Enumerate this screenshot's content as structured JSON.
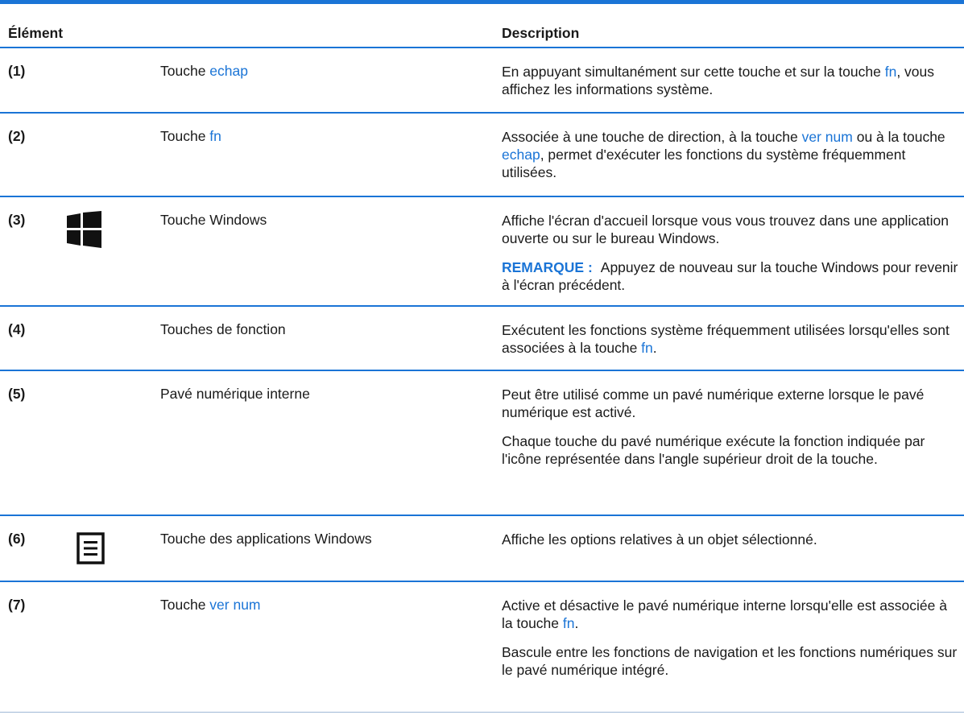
{
  "table": {
    "headers": {
      "element": "Élément",
      "description": "Description"
    },
    "rows": {
      "r1": {
        "num": "(1)",
        "item_prefix": "Touche ",
        "item_link": "echap",
        "desc_a": "En appuyant simultanément sur cette touche et sur la touche ",
        "desc_link": "fn",
        "desc_b": ", vous affichez les informations système."
      },
      "r2": {
        "num": "(2)",
        "item_prefix": "Touche ",
        "item_link": "fn",
        "desc_a": "Associée à une touche de direction, à la touche ",
        "desc_link1": "ver num",
        "desc_b": " ou à la touche ",
        "desc_link2": "echap",
        "desc_c": ", permet d'exécuter les fonctions du système fréquemment utilisées."
      },
      "r3": {
        "num": "(3)",
        "icon": "windows-logo-icon",
        "item": "Touche Windows",
        "desc": "Affiche l'écran d'accueil lorsque vous vous trouvez dans une application ouverte ou sur le bureau Windows.",
        "note_label": "REMARQUE :",
        "note_text": "Appuyez de nouveau sur la touche Windows pour revenir à l'écran précédent."
      },
      "r4": {
        "num": "(4)",
        "item": "Touches de fonction",
        "desc_a": "Exécutent les fonctions système fréquemment utilisées lorsqu'elles sont associées à la touche ",
        "desc_link": "fn",
        "desc_b": "."
      },
      "r5": {
        "num": "(5)",
        "item": "Pavé numérique interne",
        "desc1": "Peut être utilisé comme un pavé numérique externe lorsque le pavé numérique est activé.",
        "desc2": "Chaque touche du pavé numérique exécute la fonction indiquée par l'icône représentée dans l'angle supérieur droit de la touche."
      },
      "r6": {
        "num": "(6)",
        "icon": "applications-menu-icon",
        "item": "Touche des applications Windows",
        "desc": "Affiche les options relatives à un objet sélectionné."
      },
      "r7": {
        "num": "(7)",
        "item_prefix": "Touche ",
        "item_link": "ver num",
        "desc_a": "Active et désactive le pavé numérique interne lorsqu'elle est associée à la touche ",
        "desc_link": "fn",
        "desc_b": ".",
        "desc2": "Bascule entre les fonctions de navigation et les fonctions numériques sur le pavé numérique intégré."
      }
    }
  },
  "colors": {
    "accent": "#1a74d6",
    "text": "#1a1a1a"
  }
}
